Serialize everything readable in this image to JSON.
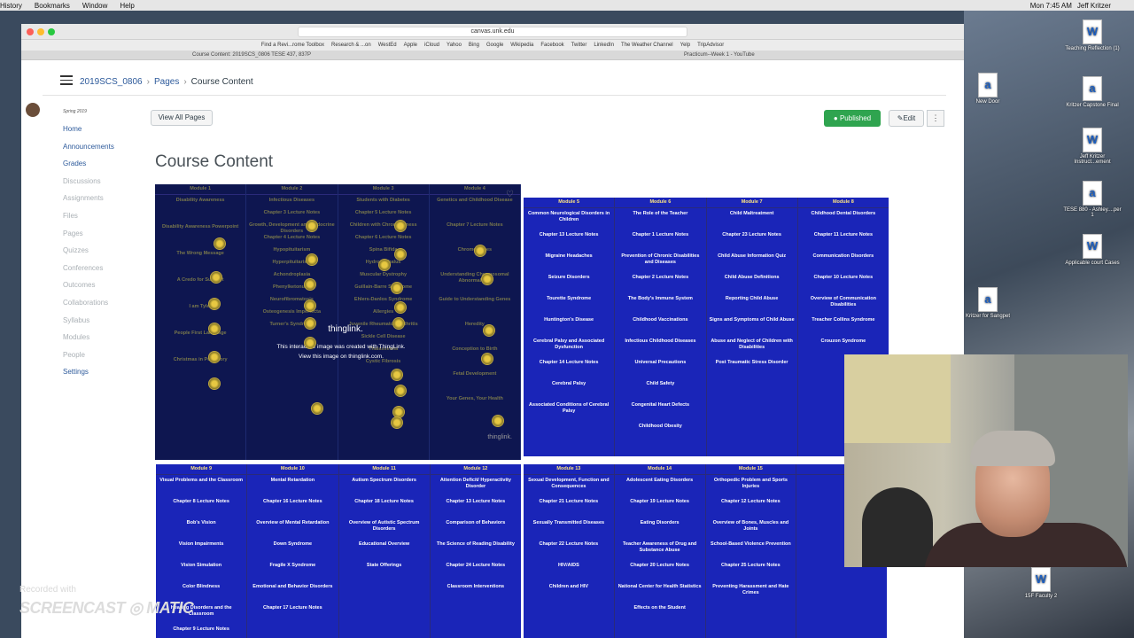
{
  "menubar": {
    "items": [
      "History",
      "Bookmarks",
      "Window",
      "Help"
    ],
    "time": "Mon 7:45 AM",
    "user": "Jeff Kritzer"
  },
  "browser": {
    "url": "canvas.unk.edu",
    "favorites": [
      "Find a Revi...rome Toolbox",
      "Research & ...on",
      "WestEd",
      "Apple",
      "iCloud",
      "Yahoo",
      "Bing",
      "Google",
      "Wikipedia",
      "Facebook",
      "Twitter",
      "LinkedIn",
      "The Weather Channel",
      "Yelp",
      "TripAdvisor"
    ],
    "tab1": "Course Content: 2019SCS_0806 TESE 437, 837P",
    "tab2": "Practicum--Week 1 - YouTube"
  },
  "breadcrumb": {
    "course": "2019SCS_0806",
    "pages": "Pages",
    "current": "Course Content"
  },
  "nav": {
    "term": "Spring 2019",
    "items": [
      "Home",
      "Announcements",
      "Grades",
      "Discussions",
      "Assignments",
      "Files",
      "Pages",
      "Quizzes",
      "Conferences",
      "Outcomes",
      "Collaborations",
      "Syllabus",
      "Modules",
      "People",
      "Settings"
    ]
  },
  "toolbar": {
    "view_all": "View All Pages",
    "published": "Published",
    "edit": "Edit",
    "more": "⋮"
  },
  "page_title": "Course Content",
  "thinglink": {
    "logo": "thinglink.",
    "note1": "This interactive image was created with ThingLink.",
    "note2": "View this image on thinglink.com.",
    "badge": "thinglink.",
    "headers": [
      "Module 1",
      "Module 2",
      "Module 3",
      "Module 4"
    ],
    "cols": [
      [
        "Disability Awareness",
        "Disability Awareness Powerpoint",
        "The Wrong Message",
        "A Credo for Support",
        "I am Tyler",
        "People First Language",
        "Christmas in Purgatory"
      ],
      [
        "Infectious Diseases",
        "Chapter 3 Lecture Notes",
        "Growth, Development and Endocrine Disorders",
        "Chapter 4 Lecture Notes",
        "Hypopituitarism",
        "Hyperpituitarism",
        "Achondroplasia",
        "Phenylketonuria",
        "Neurofibromatosis",
        "Osteogenesis Imperfecta",
        "Turner's Syndrome"
      ],
      [
        "Students with Diabetes",
        "Chapter 5 Lecture Notes",
        "Children with Chronic Illness",
        "Chapter 6 Lecture Notes",
        "Spina Bifida",
        "Hydrocephalus",
        "Muscular Dystrophy",
        "Guillain-Barre Syndrome",
        "Ehlers-Danlos Syndrome",
        "Allergies",
        "Juvenile Rheumatoid Arthritis",
        "Sickle Cell Disease",
        "Thalassemia",
        "Cystic Fibrosis"
      ],
      [
        "Genetics and Childhood Disease",
        "Chapter 7 Lecture Notes",
        "Chromosomes",
        "Understanding Chromosomal Abnormalities",
        "Guide to Understanding Genes",
        "Heredity",
        "Conception to Birth",
        "Fetal Development",
        "Your Genes, Your Health"
      ]
    ]
  },
  "grid_a": {
    "headers": [
      "Module 5",
      "Module 6",
      "Module 7",
      "Module 8"
    ],
    "cols": [
      [
        "Common Neurological Disorders in Children",
        "Chapter 13 Lecture Notes",
        "Migraine Headaches",
        "Seizure Disorders",
        "Tourette Syndrome",
        "Huntington's Disease",
        "Cerebral Palsy and Associated Dysfunction",
        "Chapter 14 Lecture Notes",
        "Cerebral Palsy",
        "Associated Conditions of Cerebral Palsy"
      ],
      [
        "The Role of the Teacher",
        "Chapter 1 Lecture Notes",
        "Prevention of Chronic Disabilities and Diseases",
        "Chapter 2 Lecture Notes",
        "The Body's Immune System",
        "Childhood Vaccinations",
        "Infectious Childhood Diseases",
        "Universal Precautions",
        "Child Safety",
        "Congenital Heart Defects",
        "Childhood Obesity"
      ],
      [
        "Child Maltreatment",
        "Chapter 23 Lecture Notes",
        "Child Abuse Information Quiz",
        "Child Abuse Definitions",
        "Reporting Child Abuse",
        "Signs and Symptoms of Child Abuse",
        "Abuse and Neglect of Children with Disabilities",
        "Post Traumatic Stress Disorder"
      ],
      [
        "Childhood Dental Disorders",
        "Chapter 11 Lecture Notes",
        "Communication Disorders",
        "Chapter 10 Lecture Notes",
        "Overview of Communication Disabilities",
        "Treacher Collins Syndrome",
        "Crouzon Syndrome"
      ]
    ]
  },
  "grid_b": {
    "headers": [
      "Module 9",
      "Module 10",
      "Module 11",
      "Module 12"
    ],
    "cols": [
      [
        "Visual Problems and the Classroom",
        "Chapter 8 Lecture Notes",
        "Bob's Vision",
        "Vision Impairments",
        "Vision Simulation",
        "Color Blindness",
        "Hearing Disorders and the Classroom",
        "Chapter 9 Lecture Notes"
      ],
      [
        "Mental Retardation",
        "Chapter 16 Lecture Notes",
        "Overview of Mental Retardation",
        "Down Syndrome",
        "Fragile X Syndrome",
        "Emotional and Behavior Disorders",
        "Chapter 17 Lecture Notes"
      ],
      [
        "Autism Spectrum Disorders",
        "Chapter 18 Lecture Notes",
        "Overview of Autistic Spectrum Disorders",
        "Educational Overview",
        "State Offerings"
      ],
      [
        "Attention Deficit/ Hyperactivity Disorder",
        "Chapter 13 Lecture Notes",
        "Comparison of Behaviors",
        "The Science of Reading Disability",
        "Chapter 24 Lecture Notes",
        "Classroom Interventions"
      ]
    ]
  },
  "grid_c": {
    "headers": [
      "Module 13",
      "Module 14",
      "Module 15",
      ""
    ],
    "cols": [
      [
        "Sexual Development, Function and Consequences",
        "Chapter 21 Lecture Notes",
        "Sexually Transmitted Diseases",
        "Chapter 22 Lecture Notes",
        "HIV/AIDS",
        "Children and HIV"
      ],
      [
        "Adolescent Eating Disorders",
        "Chapter 19 Lecture Notes",
        "Eating Disorders",
        "Teacher Awareness of Drug and Substance Abuse",
        "Chapter 20 Lecture Notes",
        "National Center for Health Statistics",
        "Effects on the Student"
      ],
      [
        "Orthopedic Problem and Sports Injuries",
        "Chapter 12 Lecture Notes",
        "Overview of Bones, Muscles and Joints",
        "School-Based Violence Prevention",
        "Chapter 25 Lecture Notes",
        "Preventing Harassment and Hate Crimes"
      ],
      []
    ]
  },
  "desktop": {
    "icons": [
      "Teaching Reflection (1)",
      "New Door",
      "Kritzer Capstone Final",
      "Jeff Kritzer Instruct...ement",
      "TESE 880 - Ashley....per 1",
      "Applicable court Cases",
      "Kritzer for Sangpet",
      "15F Faculty 2"
    ]
  },
  "screencast": {
    "recorded": "Recorded with",
    "logo": "SCREENCAST ◎ MATIC"
  },
  "colors": {
    "grid_bg": "#1a25b8",
    "header_text": "#ffe680",
    "published": "#2fa44f",
    "link": "#2d5a9b"
  }
}
